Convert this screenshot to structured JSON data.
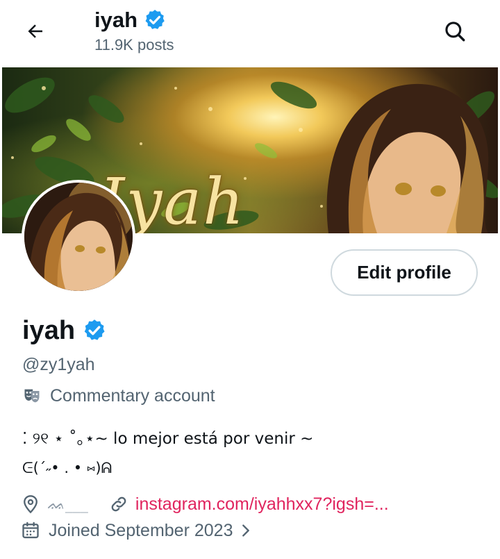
{
  "header": {
    "name": "iyah",
    "posts": "11.9K posts",
    "back_icon": "arrow-left-icon",
    "search_icon": "search-icon"
  },
  "banner": {
    "script_text": "Iyah"
  },
  "profile": {
    "edit_label": "Edit profile",
    "name": "iyah",
    "verified_icon": "verified-badge-icon",
    "handle": "@zy1yah",
    "category_icon": "theater-masks-icon",
    "category": "Commentary account",
    "bio_line1": "⁚ ୨୧  ⋆ ˚｡⋆~ lo mejor está por venir ~",
    "bio_line2": "ᕮ(´˶• . • ⑅)ᕱ",
    "location": "ᨐ___",
    "link": "instagram.com/iyahhxx7?igsh=...",
    "joined": "Joined September 2023"
  },
  "colors": {
    "verified": "#1d9bf0",
    "link": "#e0245e",
    "secondary_text": "#536471",
    "primary_text": "#0f1419"
  }
}
